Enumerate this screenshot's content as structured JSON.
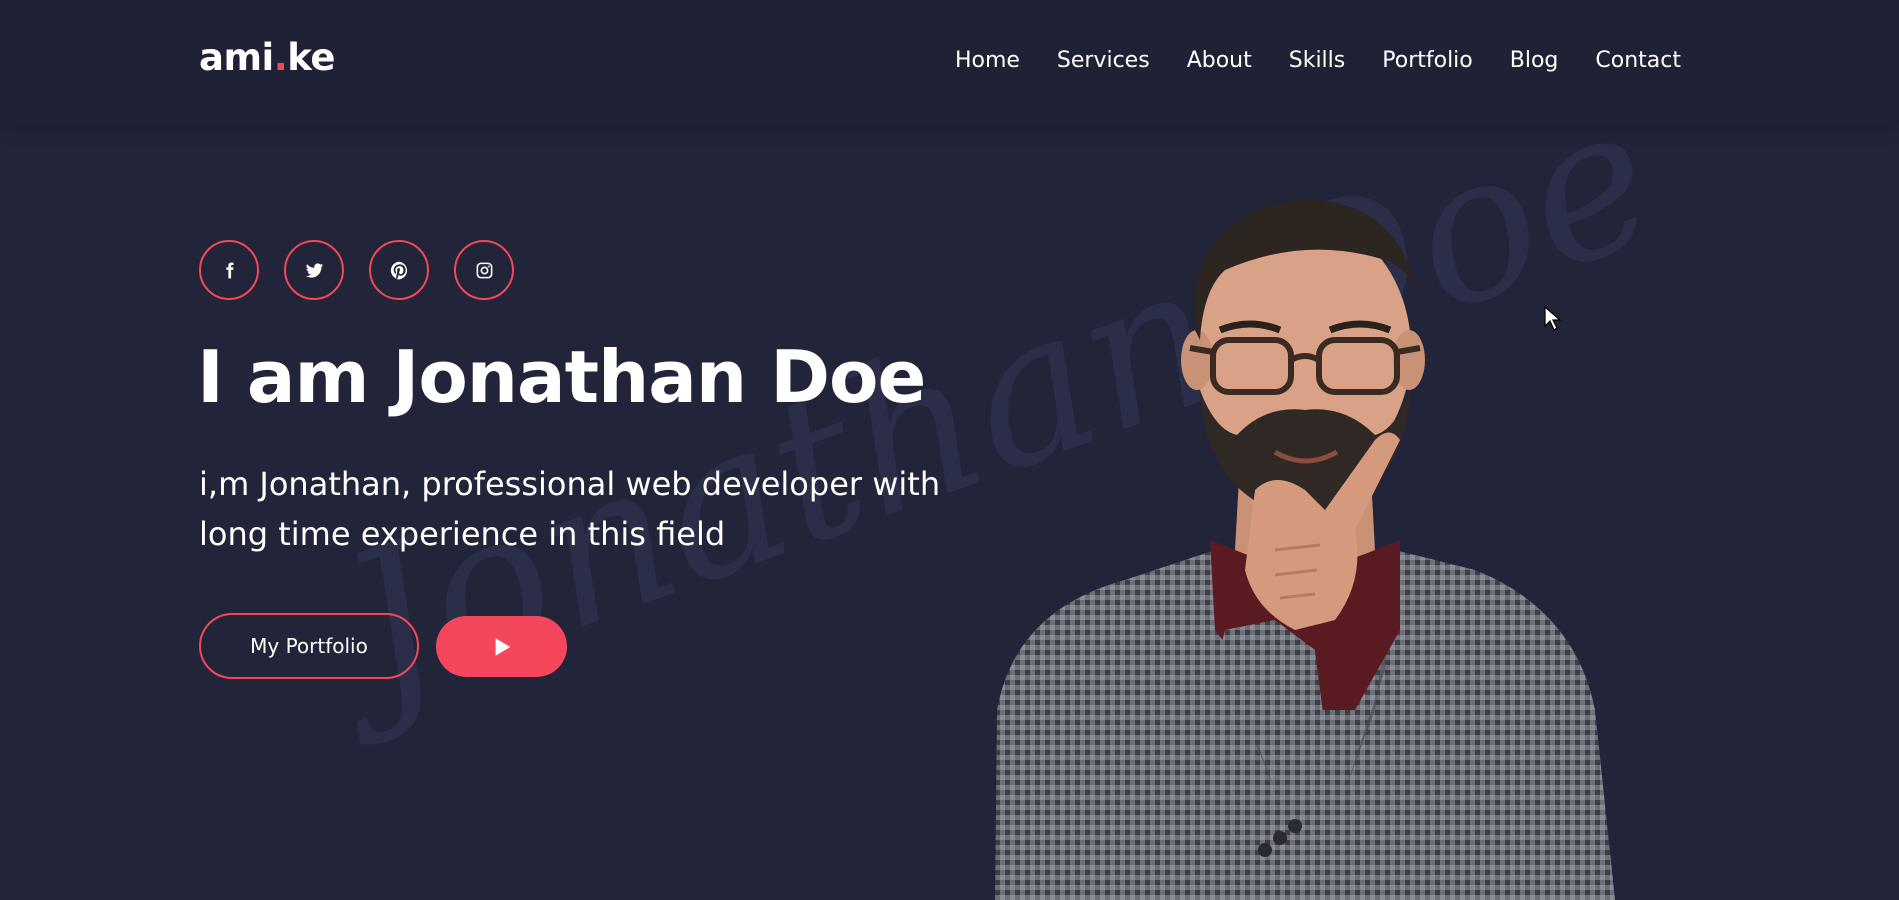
{
  "header": {
    "logo": {
      "part1": "ami",
      "dot": ".",
      "part2": "ke"
    },
    "nav": [
      "Home",
      "Services",
      "About",
      "Skills",
      "Portfolio",
      "Blog",
      "Contact"
    ]
  },
  "hero": {
    "watermark": "Jonathan Doe",
    "socials": [
      "facebook-icon",
      "twitter-icon",
      "pinterest-icon",
      "instagram-icon"
    ],
    "title": "I am Jonathan Doe",
    "subtitle_line1": "i,m Jonathan, professional web developer with",
    "subtitle_line2": "long time experience in this field",
    "portfolio_button": "My Portfolio",
    "play_button_icon": "play-icon"
  },
  "colors": {
    "background": "#22243a",
    "header": "#1f2135",
    "accent": "#f5475b",
    "text": "#ffffff"
  }
}
